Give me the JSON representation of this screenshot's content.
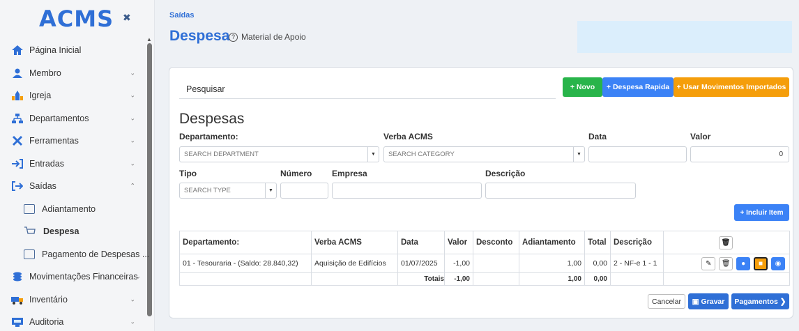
{
  "sidebar": {
    "logo": "ACMS",
    "items": [
      {
        "label": "Página Inicial",
        "icon": "home-icon"
      },
      {
        "label": "Membro",
        "icon": "user-icon"
      },
      {
        "label": "Igreja",
        "icon": "church-icon"
      },
      {
        "label": "Departamentos",
        "icon": "sitemap-icon"
      },
      {
        "label": "Ferramentas",
        "icon": "tools-icon"
      },
      {
        "label": "Entradas",
        "icon": "sign-in-icon"
      },
      {
        "label": "Saídas",
        "icon": "sign-out-icon"
      },
      {
        "label": "Adiantamento",
        "icon": "cash-icon"
      },
      {
        "label": "Despesa",
        "icon": "cart-icon"
      },
      {
        "label": "Pagamento de Despesas ...",
        "icon": "list-icon"
      },
      {
        "label": "Movimentações Financeiras",
        "icon": "coins-icon"
      },
      {
        "label": "Inventário",
        "icon": "truck-icon"
      },
      {
        "label": "Auditoria",
        "icon": "audit-icon"
      }
    ]
  },
  "header": {
    "breadcrumb": "Saídas",
    "title": "Despesa",
    "help": "Material de Apoio"
  },
  "toolbar": {
    "search_label": "Pesquisar",
    "novo": "Novo",
    "despesa_rapida": "Despesa Rapida",
    "usar": "Usar Movimentos Importados"
  },
  "form": {
    "heading": "Despesas",
    "departamento_label": "Departamento:",
    "departamento_placeholder": "SEARCH DEPARTMENT",
    "verba_label": "Verba ACMS",
    "verba_placeholder": "SEARCH CATEGORY",
    "data_label": "Data",
    "data_value": "",
    "valor_label": "Valor",
    "valor_value": "0",
    "tipo_label": "Tipo",
    "tipo_placeholder": "SEARCH TYPE",
    "numero_label": "Número",
    "empresa_label": "Empresa",
    "descricao_label": "Descrição",
    "incluir": "Incluir Item"
  },
  "table": {
    "headers": [
      "Departamento:",
      "Verba ACMS",
      "Data",
      "Valor",
      "Desconto",
      "Adiantamento",
      "Total",
      "Descrição"
    ],
    "row": {
      "departamento": "01 - Tesouraria - (Saldo: 28.840,32)",
      "verba": "Aquisição de Edifícios",
      "data": "01/07/2025",
      "valor": "-1,00",
      "desconto": "",
      "adiantamento": "1,00",
      "total": "0,00",
      "descricao": "2 - NF-e 1 - 1"
    },
    "totals": {
      "label": "Totais",
      "valor": "-1,00",
      "adiantamento": "1,00",
      "total": "0,00"
    }
  },
  "footer": {
    "cancelar": "Cancelar",
    "gravar": "Gravar",
    "pagamentos": "Pagamentos"
  },
  "colors": {
    "primary": "#2f6fd6",
    "green": "#28b44a",
    "blue": "#3b82f6",
    "orange": "#f59e0b"
  }
}
